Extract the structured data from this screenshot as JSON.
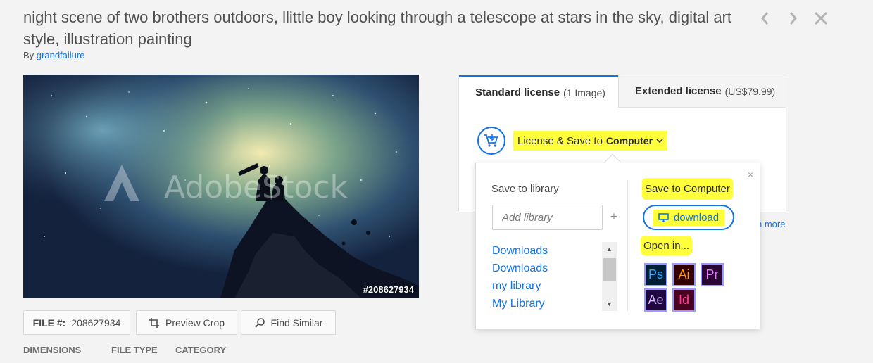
{
  "header": {
    "title": "night scene of two brothers outdoors, llittle boy looking through a telescope at stars in the sky, digital art style, illustration painting",
    "by_label": "By",
    "author": "grandfailure"
  },
  "nav": {
    "prev_icon": "chevron-left-icon",
    "next_icon": "chevron-right-icon",
    "close_icon": "close-icon"
  },
  "image": {
    "watermark": "AdobeStock",
    "id_label": "#208627934"
  },
  "actions": {
    "file_label": "FILE #:",
    "file_number": "208627934",
    "preview_crop": "Preview Crop",
    "find_similar": "Find Similar"
  },
  "metadata": {
    "dimensions_label": "DIMENSIONS",
    "file_type_label": "FILE TYPE",
    "category_label": "CATEGORY"
  },
  "license": {
    "standard_label": "Standard license",
    "standard_sub": "(1 Image)",
    "extended_label": "Extended license",
    "extended_sub": "(US$79.99)",
    "save_label": "License & Save to",
    "save_target": "Computer",
    "learn_more": "n more"
  },
  "popover": {
    "save_to_library": "Save to library",
    "add_library_placeholder": "Add library",
    "plus": "+",
    "libraries": [
      "Downloads",
      "Downloads",
      "my library",
      "My Library"
    ],
    "save_to_computer": "Save to Computer",
    "download": "download",
    "open_in": "Open in...",
    "close": "×",
    "apps": [
      {
        "label": "Ps",
        "fg": "#31a8ff",
        "bg": "#001e36",
        "border": "#31a8ff"
      },
      {
        "label": "Ai",
        "fg": "#ff9a00",
        "bg": "#330000",
        "border": "#ff9a00"
      },
      {
        "label": "Pr",
        "fg": "#e77bff",
        "bg": "#2a0634",
        "border": "#9999ff"
      },
      {
        "label": "Ae",
        "fg": "#d8b6ff",
        "bg": "#1f0740",
        "border": "#9999ff"
      },
      {
        "label": "Id",
        "fg": "#ff3f94",
        "bg": "#49021f",
        "border": "#ff3f94"
      }
    ]
  },
  "colors": {
    "accent": "#1473e6",
    "highlight": "#ffff3c"
  }
}
